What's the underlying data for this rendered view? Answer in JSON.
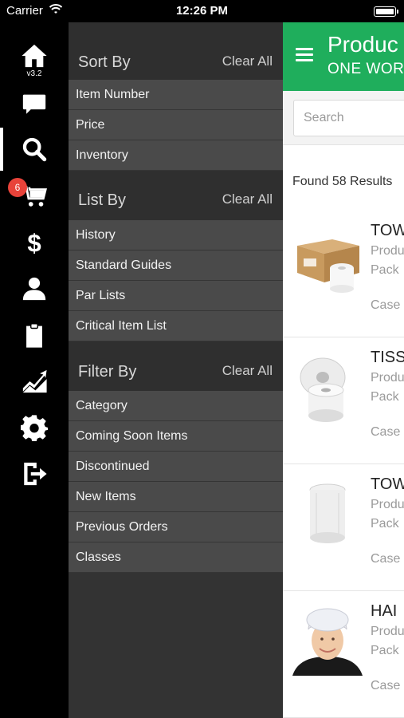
{
  "status_bar": {
    "carrier": "Carrier",
    "time": "12:26 PM"
  },
  "rail": {
    "version": "v3.2",
    "cart_badge": "6",
    "items": [
      {
        "icon": "home-icon"
      },
      {
        "icon": "chat-icon"
      },
      {
        "icon": "search-icon"
      },
      {
        "icon": "cart-icon"
      },
      {
        "icon": "dollar-icon"
      },
      {
        "icon": "user-icon"
      },
      {
        "icon": "clipboard-icon"
      },
      {
        "icon": "chart-icon"
      },
      {
        "icon": "gear-icon"
      },
      {
        "icon": "logout-icon"
      }
    ]
  },
  "sort_by": {
    "title": "Sort By",
    "clear": "Clear All",
    "options": [
      "Item Number",
      "Price",
      "Inventory"
    ]
  },
  "list_by": {
    "title": "List By",
    "clear": "Clear All",
    "options": [
      "History",
      "Standard Guides",
      "Par Lists",
      "Critical Item List"
    ]
  },
  "filter_by": {
    "title": "Filter By",
    "clear": "Clear All",
    "options": [
      "Category",
      "Coming Soon Items",
      "Discontinued",
      "New Items",
      "Previous Orders",
      "Classes"
    ]
  },
  "header": {
    "title": "Produc",
    "subtitle": "ONE WOR"
  },
  "search": {
    "placeholder": "Search"
  },
  "results_label": "Found 58 Results",
  "products": [
    {
      "name": "TOW",
      "line1": "Produ",
      "line2": "Pack",
      "unit": "Case",
      "image": "paper-towel-box"
    },
    {
      "name": "TISS",
      "line1": "Produ",
      "line2": "Pack",
      "unit": "Case",
      "image": "toilet-tissue-rolls"
    },
    {
      "name": "TOW",
      "line1": "Produ",
      "line2": "Pack",
      "unit": "Case",
      "image": "wrapped-towel-roll"
    },
    {
      "name": "HAI",
      "line1": "Produ",
      "line2": "Pack",
      "unit": "Case",
      "image": "hairnet-photo"
    }
  ],
  "colors": {
    "brand_green": "#1fae5c",
    "panel_dark": "#333333",
    "option_gray": "#4a4a4a",
    "badge_red": "#e8433a"
  }
}
